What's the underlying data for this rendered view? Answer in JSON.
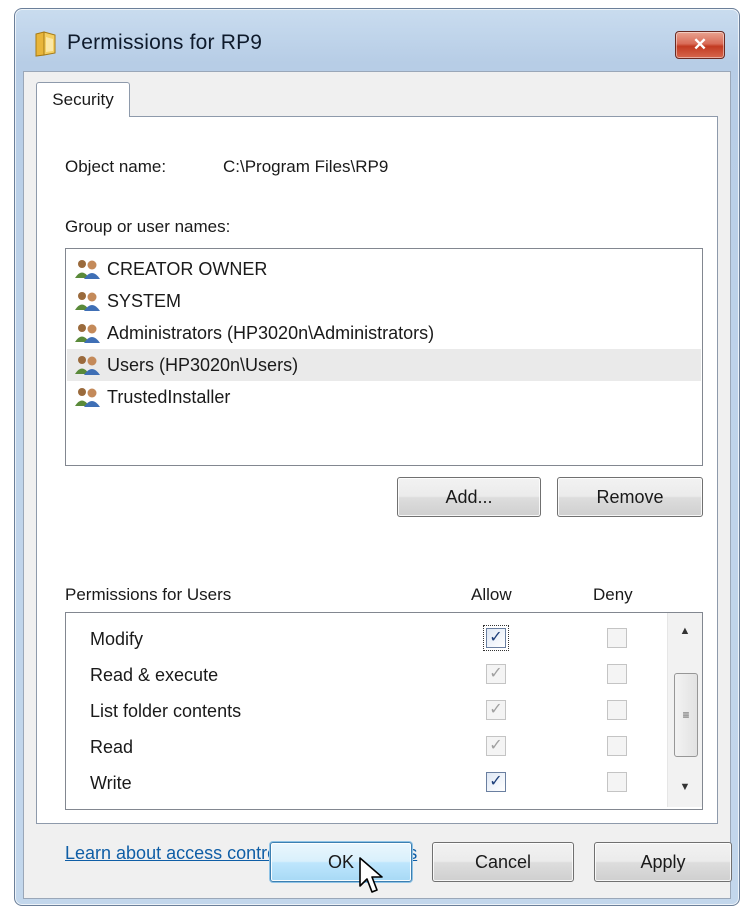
{
  "window": {
    "title": "Permissions for RP9",
    "close_label": "✕"
  },
  "tabs": [
    {
      "label": "Security"
    }
  ],
  "object": {
    "label": "Object name:",
    "value": "C:\\Program Files\\RP9"
  },
  "groups": {
    "label": "Group or user names:",
    "items": [
      {
        "name": "CREATOR OWNER",
        "icon": "users-group-icon"
      },
      {
        "name": "SYSTEM",
        "icon": "users-group-icon"
      },
      {
        "name": "Administrators (HP3020n\\Administrators)",
        "icon": "users-group-icon"
      },
      {
        "name": "Users (HP3020n\\Users)",
        "icon": "users-group-icon",
        "selected": true
      },
      {
        "name": "TrustedInstaller",
        "icon": "users-group-icon"
      }
    ],
    "add_label": "Add...",
    "remove_label": "Remove"
  },
  "permissions": {
    "header": "Permissions for Users",
    "allow_header": "Allow",
    "deny_header": "Deny",
    "rows": [
      {
        "name": "Modify",
        "allow": "checked",
        "deny": "unchecked-disabled"
      },
      {
        "name": "Read & execute",
        "allow": "checked-disabled",
        "deny": "unchecked-disabled"
      },
      {
        "name": "List folder contents",
        "allow": "checked-disabled",
        "deny": "unchecked-disabled"
      },
      {
        "name": "Read",
        "allow": "checked-disabled",
        "deny": "unchecked-disabled"
      },
      {
        "name": "Write",
        "allow": "checked",
        "deny": "unchecked-disabled"
      }
    ],
    "check_glyph": "✓"
  },
  "learn_link": "Learn about access control and permissions",
  "footer": {
    "ok_label": "OK",
    "cancel_label": "Cancel",
    "apply_label": "Apply"
  },
  "colors": {
    "frame": "#bed3ea",
    "link": "#0f5ea6",
    "close": "#c23b22",
    "selection": "#eaeaea"
  }
}
